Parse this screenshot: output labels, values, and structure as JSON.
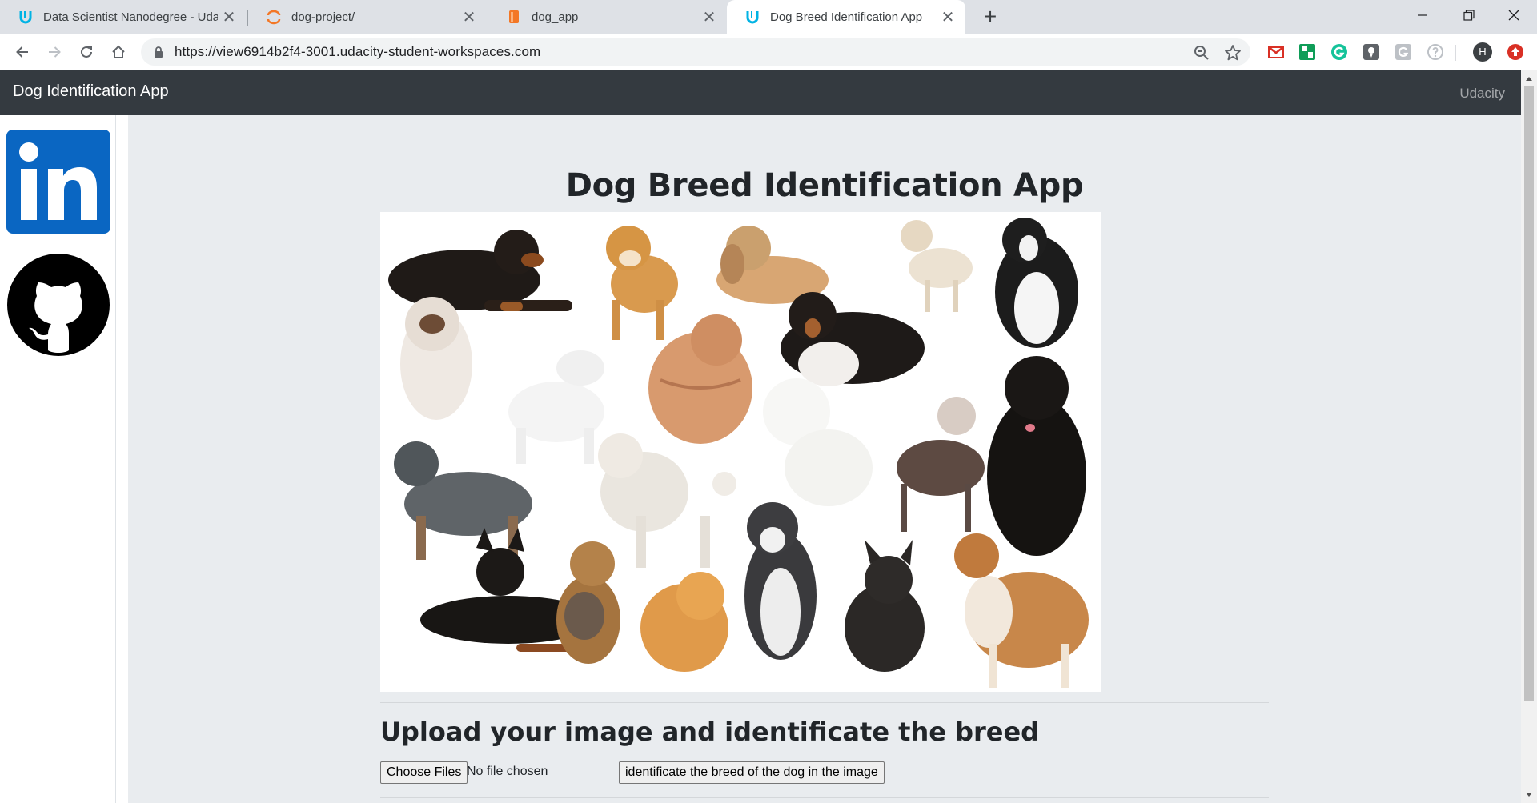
{
  "browser": {
    "tabs": [
      {
        "title": "Data Scientist Nanodegree - Uda",
        "favicon": "udacity-icon",
        "active": false
      },
      {
        "title": "dog-project/",
        "favicon": "jupyter-icon",
        "active": false
      },
      {
        "title": "dog_app",
        "favicon": "notebook-icon",
        "active": false
      },
      {
        "title": "Dog Breed Identification App",
        "favicon": "udacity-icon",
        "active": true
      }
    ],
    "close_glyph": "✕",
    "new_tab_glyph": "+",
    "url": "https://view6914b2f4-3001.udacity-student-workspaces.com",
    "profile_initial": "H",
    "colors": {
      "tab_strip": "#dee1e6",
      "omnibox": "#f1f3f4",
      "udacity": "#02b3e4"
    }
  },
  "navbar": {
    "brand": "Dog Identification App",
    "link": "Udacity"
  },
  "sidebar": {
    "linkedin": "in"
  },
  "main": {
    "title": "Dog Breed Identification App",
    "upload_title": "Upload your image and identificate the breed",
    "choose_files": "Choose Files",
    "no_file": "No file chosen",
    "submit": "identificate the breed of the dog in the image"
  }
}
